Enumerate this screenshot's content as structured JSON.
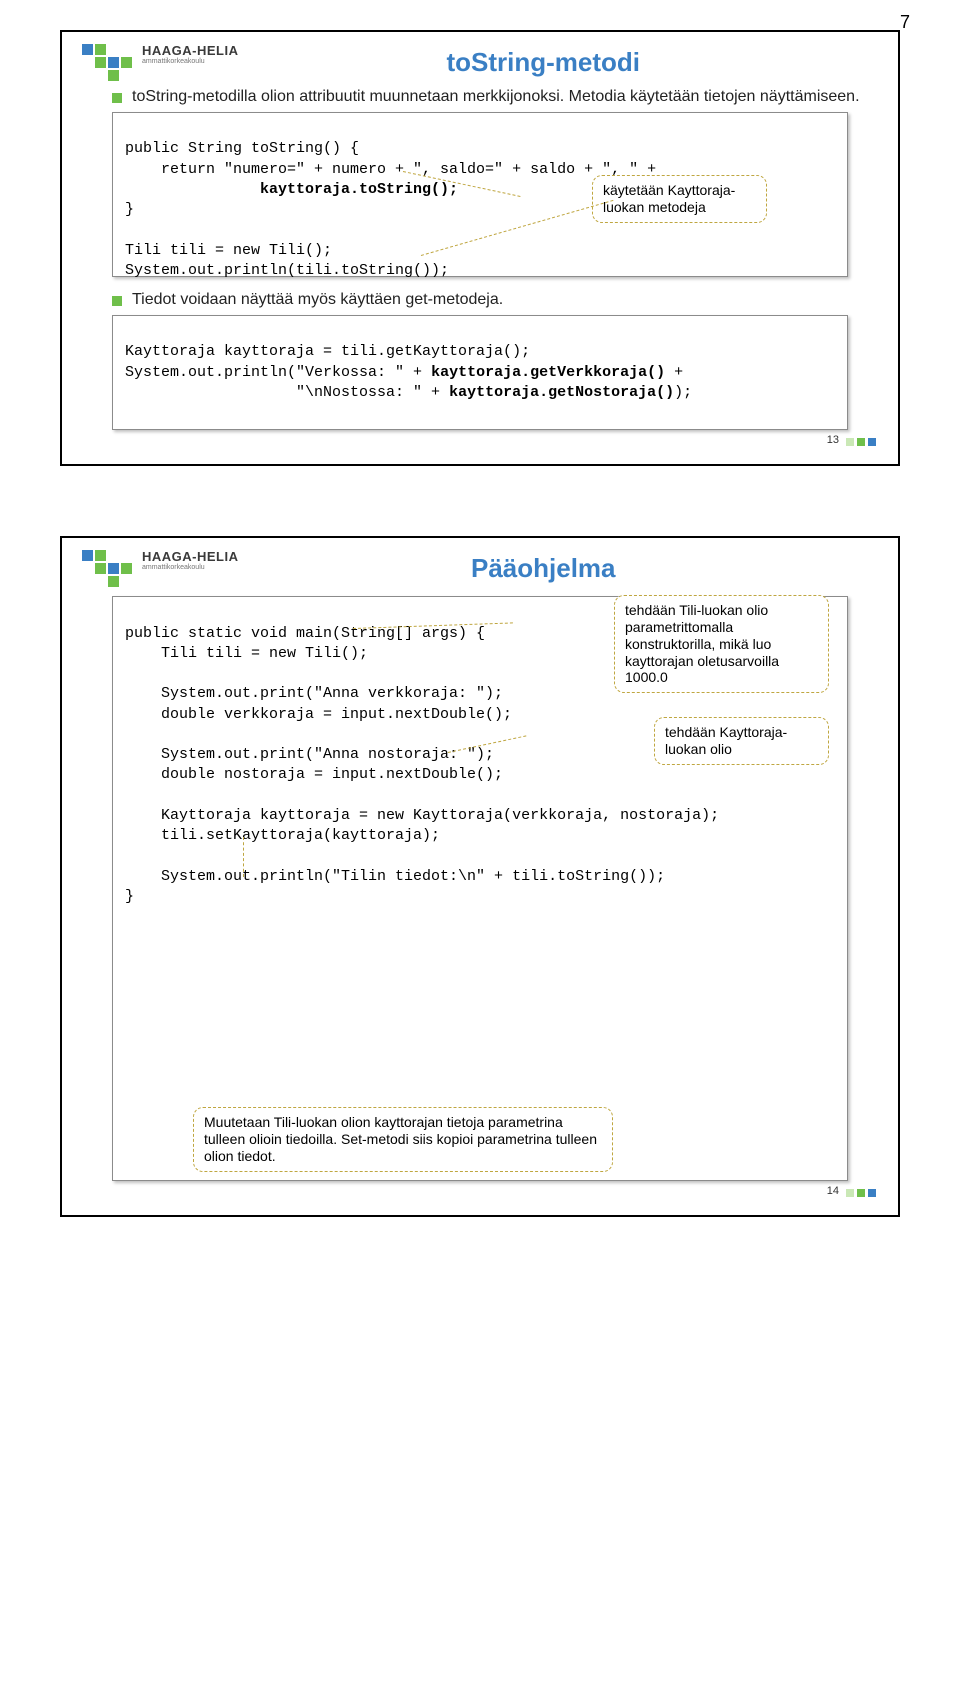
{
  "page_number_top": "7",
  "logo": {
    "main": "HAAGA-HELIA",
    "sub": "ammattikorkeakoulu"
  },
  "slide1": {
    "title": "toString-metodi",
    "bullet1": "toString-metodilla olion attribuutit muunnetaan merkkijonoksi. Metodia käytetään tietojen näyttämiseen.",
    "code1_l1": "public String toString() {",
    "code1_l2": "    return \"numero=\" + numero + \", saldo=\" + saldo + \", \" +",
    "code1_l3": "               kayttoraja.toString();",
    "code1_l4": "}",
    "code1_l5": "Tili tili = new Tili();",
    "code1_l6": "System.out.println(tili.toString());",
    "callout1": "käytetään Kayttoraja-luokan metodeja",
    "bullet2": "Tiedot voidaan näyttää myös käyttäen get-metodeja.",
    "code2_l1": "Kayttoraja kayttoraja = tili.getKayttoraja();",
    "code2_l2": "System.out.println(\"Verkossa: \" + kayttoraja.getVerkkoraja() +",
    "code2_l3": "                   \"\\nNostossa: \" + kayttoraja.getNostoraja());",
    "slide_num": "13"
  },
  "slide2": {
    "title": "Pääohjelma",
    "code_l1": "public static void main(String[] args) {",
    "code_l2": "    Tili tili = new Tili();",
    "code_l3": "",
    "code_l4": "    System.out.print(\"Anna verkkoraja: \");",
    "code_l5": "    double verkkoraja = input.nextDouble();",
    "code_l6": "",
    "code_l7": "    System.out.print(\"Anna nostoraja: \");",
    "code_l8": "    double nostoraja = input.nextDouble();",
    "code_l9": "",
    "code_l10": "    Kayttoraja kayttoraja = new Kayttoraja(verkkoraja, nostoraja);",
    "code_l11": "    tili.setKayttoraja(kayttoraja);",
    "code_l12": "",
    "code_l13": "    System.out.println(\"Tilin tiedot:\\n\" + tili.toString());",
    "code_l14": "}",
    "callout_top": "tehdään Tili-luokan olio parametrittomalla konstruktorilla, mikä luo kayttorajan oletusarvoilla 1000.0",
    "callout_mid": "tehdään Kayttoraja-luokan olio",
    "callout_bottom": "Muutetaan Tili-luokan olion kayttorajan tietoja parametrina tulleen olioin tiedoilla. Set-metodi siis kopioi parametrina tulleen olion tiedot.",
    "slide_num": "14"
  }
}
